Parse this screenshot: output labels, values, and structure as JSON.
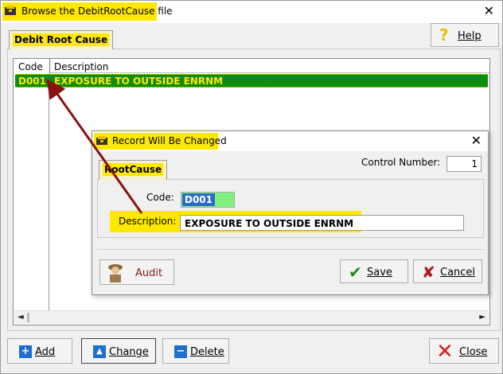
{
  "window": {
    "title": "Browse the DebitRootCause file",
    "close": "✕"
  },
  "tab": {
    "label": "Debit Root Cause"
  },
  "help": {
    "icon": "?",
    "label": "Help"
  },
  "grid": {
    "columns": [
      "Code",
      "Description"
    ],
    "rows": [
      {
        "code": "D001",
        "description": "EXPOSURE TO OUTSIDE ENRNM"
      }
    ],
    "scroll_left": "◄",
    "scroll_right": "►"
  },
  "buttons": {
    "add": {
      "icon": "+",
      "label": "Add"
    },
    "change": {
      "icon": "▲",
      "label": "Change"
    },
    "delete": {
      "icon": "−",
      "label": "Delete"
    },
    "close": {
      "icon": "✕",
      "label": "Close"
    }
  },
  "dialog": {
    "title": "Record Will Be Changed",
    "close": "✕",
    "tab_label": "RootCause",
    "control_label": "Control Number:",
    "control_value": "1",
    "code_label": "Code:",
    "code_value": "D001",
    "desc_label": "Description:",
    "desc_value": "EXPOSURE TO OUTSIDE ENRNM",
    "audit_label": "Audit",
    "save_icon": "✔",
    "save_label": "Save",
    "cancel_icon": "✘",
    "cancel_label": "Cancel"
  },
  "colors": {
    "highlight": "#ffe800",
    "row_bg": "#0d8c0d",
    "arrow": "#8b1010"
  }
}
